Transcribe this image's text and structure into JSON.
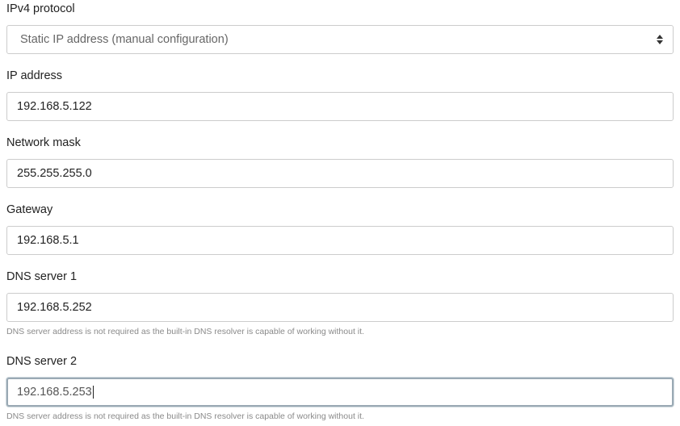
{
  "ipv4_protocol": {
    "label": "IPv4 protocol",
    "selected": "Static IP address (manual configuration)",
    "arrow_icon": "sort-arrows-icon"
  },
  "ip_address": {
    "label": "IP address",
    "value": "192.168.5.122"
  },
  "network_mask": {
    "label": "Network mask",
    "value": "255.255.255.0"
  },
  "gateway": {
    "label": "Gateway",
    "value": "192.168.5.1"
  },
  "dns_server_1": {
    "label": "DNS server 1",
    "value": "192.168.5.252",
    "help": "DNS server address is not required as the built-in DNS resolver is capable of working without it."
  },
  "dns_server_2": {
    "label": "DNS server 2",
    "value": "192.168.5.253",
    "help": "DNS server address is not required as the built-in DNS resolver is capable of working without it."
  },
  "colors": {
    "text": "#222222",
    "border": "#cccccc",
    "focus_border": "#9aa9b4",
    "help_text": "#8a8a8a"
  }
}
